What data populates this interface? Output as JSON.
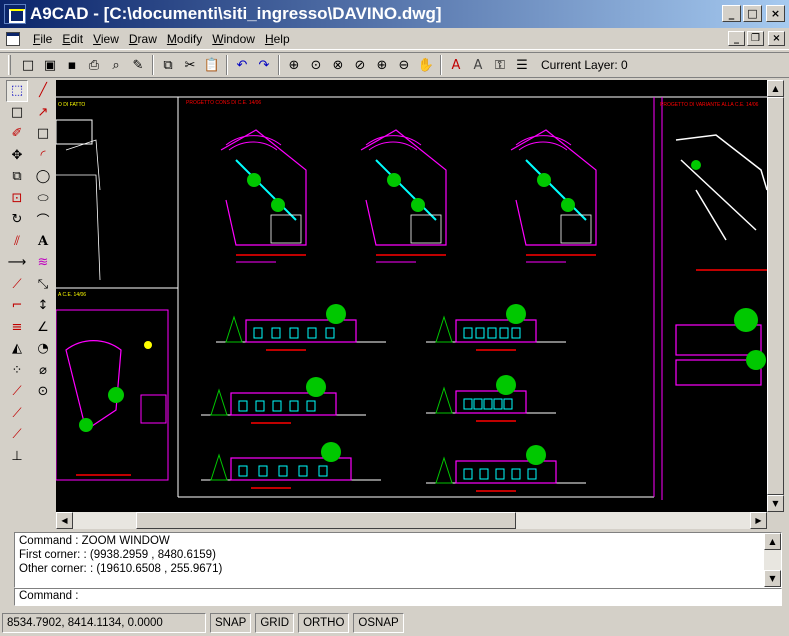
{
  "window": {
    "title": "A9CAD - [C:\\documenti\\siti_ingresso\\DAVINO.dwg]",
    "minimize": "_",
    "maximize": "□",
    "close": "×",
    "restore": "❐"
  },
  "menu": {
    "items": [
      "File",
      "Edit",
      "View",
      "Draw",
      "Modify",
      "Window",
      "Help"
    ]
  },
  "toolbar": {
    "current_layer": "Current Layer: 0",
    "tools": [
      {
        "name": "new",
        "glyph": "□"
      },
      {
        "name": "open",
        "glyph": "▣"
      },
      {
        "name": "save",
        "glyph": "▪"
      },
      {
        "name": "print",
        "glyph": "⎙"
      },
      {
        "name": "print-preview",
        "glyph": "⌕"
      },
      {
        "name": "properties",
        "glyph": "✎"
      },
      {
        "name": "sep"
      },
      {
        "name": "copy",
        "glyph": "⧉"
      },
      {
        "name": "cut",
        "glyph": "✂"
      },
      {
        "name": "paste",
        "glyph": "📋"
      },
      {
        "name": "sep"
      },
      {
        "name": "undo",
        "glyph": "↶"
      },
      {
        "name": "redo",
        "glyph": "↷"
      },
      {
        "name": "sep"
      },
      {
        "name": "zoom-window",
        "glyph": "⊕"
      },
      {
        "name": "zoom-center",
        "glyph": "⊙"
      },
      {
        "name": "zoom-realtime",
        "glyph": "⊗"
      },
      {
        "name": "zoom-previous",
        "glyph": "⊘"
      },
      {
        "name": "zoom-in",
        "glyph": "⊕"
      },
      {
        "name": "zoom-out",
        "glyph": "⊖"
      },
      {
        "name": "pan",
        "glyph": "✋"
      },
      {
        "name": "sep"
      },
      {
        "name": "text-style",
        "glyph": "A"
      },
      {
        "name": "dim-style",
        "glyph": "A"
      },
      {
        "name": "layer-properties",
        "glyph": "⚿"
      },
      {
        "name": "layer-manager",
        "glyph": "☰"
      }
    ]
  },
  "palette": {
    "col1": [
      "select",
      "square",
      "erase",
      "move",
      "copy-obj",
      "scale",
      "rotate",
      "trim",
      "extend",
      "break",
      "fillet",
      "offset",
      "mirror",
      "array",
      "point-a",
      "point-b",
      "point-c",
      "perp"
    ],
    "col2": [
      "line",
      "ray",
      "rectangle",
      "arc",
      "circle",
      "ellipse",
      "polyline",
      "text",
      "hatch",
      "dim-aligned",
      "dim-vertical",
      "dim-angular",
      "dim-radius",
      "dim-diameter",
      "dim-center"
    ]
  },
  "command": {
    "lines": [
      "Command : ZOOM WINDOW",
      "First corner: : (9938.2959 , 8480.6159)",
      "Other corner: : (19610.6508 , 255.9671)"
    ],
    "prompt": "Command :",
    "input_value": ""
  },
  "status": {
    "coords": "8534.7902, 8414.1134, 0.0000",
    "buttons": [
      "SNAP",
      "GRID",
      "ORTHO",
      "OSNAP"
    ]
  },
  "drawing": {
    "labels": [
      "PROGETTO  CONS DI C.E. 14/06",
      "PROGETTO  DI VARIANTE ALLA C.E. 14/06",
      "A C.E. 14/06",
      "O DI FATTO"
    ]
  }
}
